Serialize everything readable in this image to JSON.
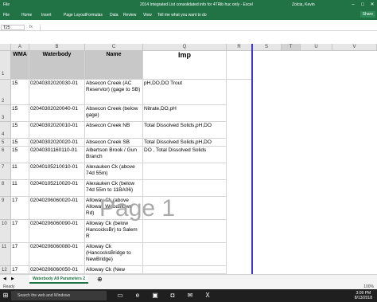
{
  "titlebar": {
    "file_label": "File",
    "title": "2014 Integrated List consolidated info for 4TRib huc only - Excel",
    "user": "Zolcia, Kevin"
  },
  "ribbon": {
    "tabs": [
      "Home",
      "Insert",
      "Page Layout",
      "Formulas",
      "Data",
      "Review",
      "View"
    ],
    "tell_me": "Tell me what you want to do",
    "share": "Share"
  },
  "formula_bar": {
    "name_box": "T25",
    "fx": "fx",
    "value": ""
  },
  "columns": [
    "A",
    "B",
    "C",
    "Q",
    "R",
    "S",
    "T",
    "U",
    "V"
  ],
  "headers": {
    "wma": "WMA",
    "waterbody": "Waterbody",
    "name": "Name",
    "imp": "Imp"
  },
  "rows": [
    {
      "num": "1",
      "wma": "",
      "waterbody": "",
      "name": "",
      "imp": ""
    },
    {
      "num": "2",
      "wma": "15",
      "waterbody": "02040302020030-01",
      "name": "Absecon Creek (AC Reservior) (gage to SB)",
      "imp": "pH,DO,DO Trout"
    },
    {
      "num": "3",
      "wma": "15",
      "waterbody": "02040302020040-01",
      "name": "Absecon Creek (below gage)",
      "imp": "Nitrate,DO,pH"
    },
    {
      "num": "4",
      "wma": "15",
      "waterbody": "02040302020010-01",
      "name": "Absecon Creek NB",
      "imp": "Total Dissolved Solids,pH,DO"
    },
    {
      "num": "5",
      "wma": "15",
      "waterbody": "02040302020020-01",
      "name": "Absecon Creek SB",
      "imp": "Total Dissolved Solids,pH,DO"
    },
    {
      "num": "6",
      "wma": "15",
      "waterbody": "02040301160110-01",
      "name": "Albertson Brook / Gun Branch",
      "imp": "DO , Total Dissolved Solids"
    },
    {
      "num": "7",
      "wma": "11",
      "waterbody": "02040105210010-01",
      "name": "Alexauken Ck (above 74d 55m)",
      "imp": ""
    },
    {
      "num": "8",
      "wma": "11",
      "waterbody": "02040105210020-01",
      "name": "Alexauken Ck (below 74d 55m to 11BA06)",
      "imp": ""
    },
    {
      "num": "9",
      "wma": "17",
      "waterbody": "02040206060020-01",
      "name": "Alloway Ck (above Alloway Woodstown Rd)",
      "imp": ""
    },
    {
      "num": "10",
      "wma": "17",
      "waterbody": "02040206060090-01",
      "name": "Alloway Ck (below HancocksBr) to Salem R",
      "imp": ""
    },
    {
      "num": "11",
      "wma": "17",
      "waterbody": "02040206060080-01",
      "name": "Alloway Ck (HancocksBridge to NewBridge)",
      "imp": ""
    },
    {
      "num": "12",
      "wma": "17",
      "waterbody": "02040206060050-01",
      "name": "Alloway Ck (New",
      "imp": ""
    }
  ],
  "page_watermark": "Page 1",
  "sheet_tab": "Waterbody All Parameters 2",
  "status": {
    "left": "Ready",
    "zoom": "100%"
  },
  "taskbar": {
    "search": "Search the web and Windows",
    "time": "3:09 PM",
    "date": "8/13/2018"
  }
}
